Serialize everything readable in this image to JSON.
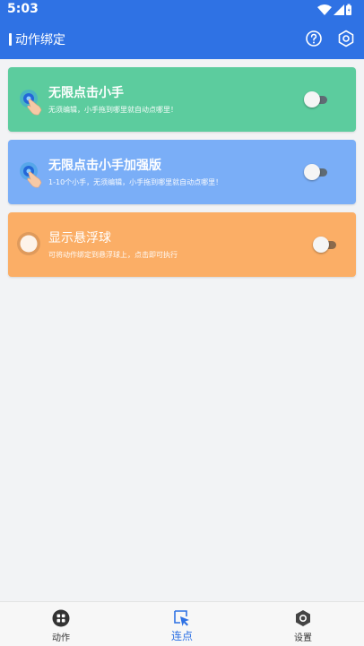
{
  "status_bar": {
    "time": "5:03"
  },
  "header": {
    "title": "动作绑定"
  },
  "cards": [
    {
      "title": "无限点击小手",
      "subtitle": "无须编辑，小手拖到哪里就自动点哪里！",
      "enabled": false,
      "color": "#5ccc9e"
    },
    {
      "title": "无限点击小手加强版",
      "subtitle": "1-10个小手，无须编辑，小手拖到哪里就自动点哪里！",
      "enabled": false,
      "color": "#7aaef7"
    },
    {
      "title": "显示悬浮球",
      "subtitle": "可将动作绑定到悬浮球上，点击即可执行",
      "enabled": false,
      "color": "#fbae66"
    }
  ],
  "bottom_nav": [
    {
      "label": "动作",
      "icon": "grid-icon",
      "selected": false
    },
    {
      "label": "连点",
      "icon": "cursor-icon",
      "selected": true
    },
    {
      "label": "设置",
      "icon": "hex-gear-icon",
      "selected": false
    }
  ],
  "colors": {
    "primary": "#2f72e4",
    "background": "#f2f3f5"
  }
}
